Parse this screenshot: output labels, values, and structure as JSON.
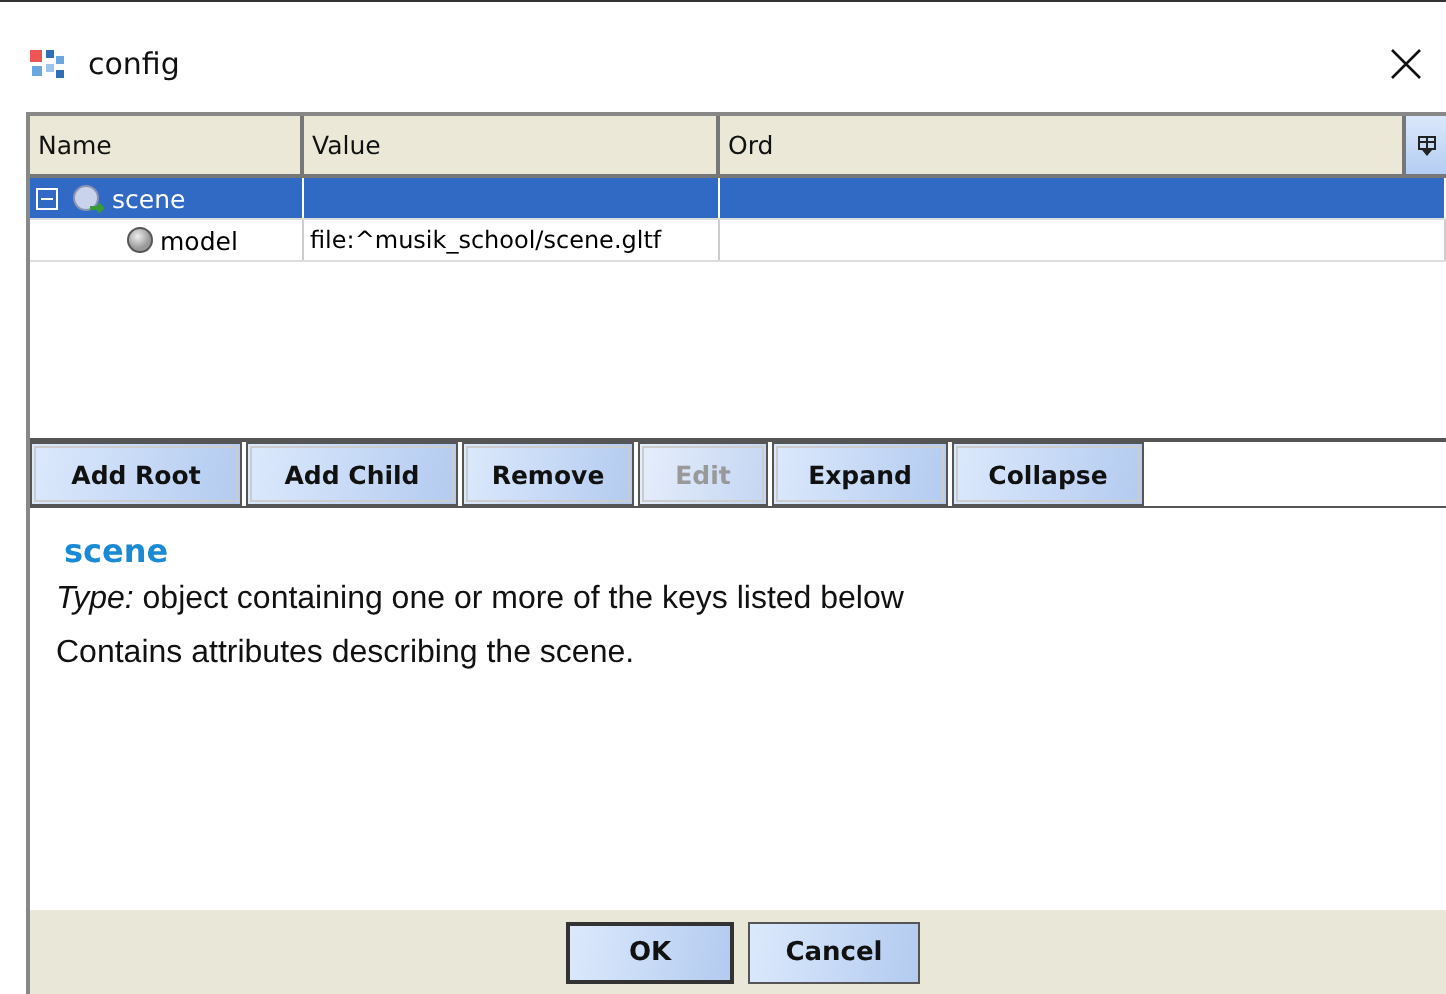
{
  "window": {
    "title": "config"
  },
  "table": {
    "columns": [
      "Name",
      "Value",
      "Ord"
    ],
    "rows": [
      {
        "name": "scene",
        "kind": "object",
        "expanded": true,
        "selected": true,
        "children": [
          {
            "name": "model",
            "value": "file:^musik_school/scene.gltf",
            "kind": "leaf",
            "selected": false
          }
        ]
      }
    ]
  },
  "toolbar": [
    {
      "label": "Add Root",
      "disabled": false
    },
    {
      "label": "Add Child",
      "disabled": false
    },
    {
      "label": "Remove",
      "disabled": false
    },
    {
      "label": "Edit",
      "disabled": true
    },
    {
      "label": "Expand",
      "disabled": false
    },
    {
      "label": "Collapse",
      "disabled": false
    }
  ],
  "description": {
    "heading": "scene",
    "type_line": "*Type:* object containing one or more of the keys listed below",
    "text": "Contains attributes describing the scene."
  },
  "footer_buttons": [
    {
      "label": "OK",
      "default": true
    },
    {
      "label": "Cancel",
      "default": false
    }
  ]
}
